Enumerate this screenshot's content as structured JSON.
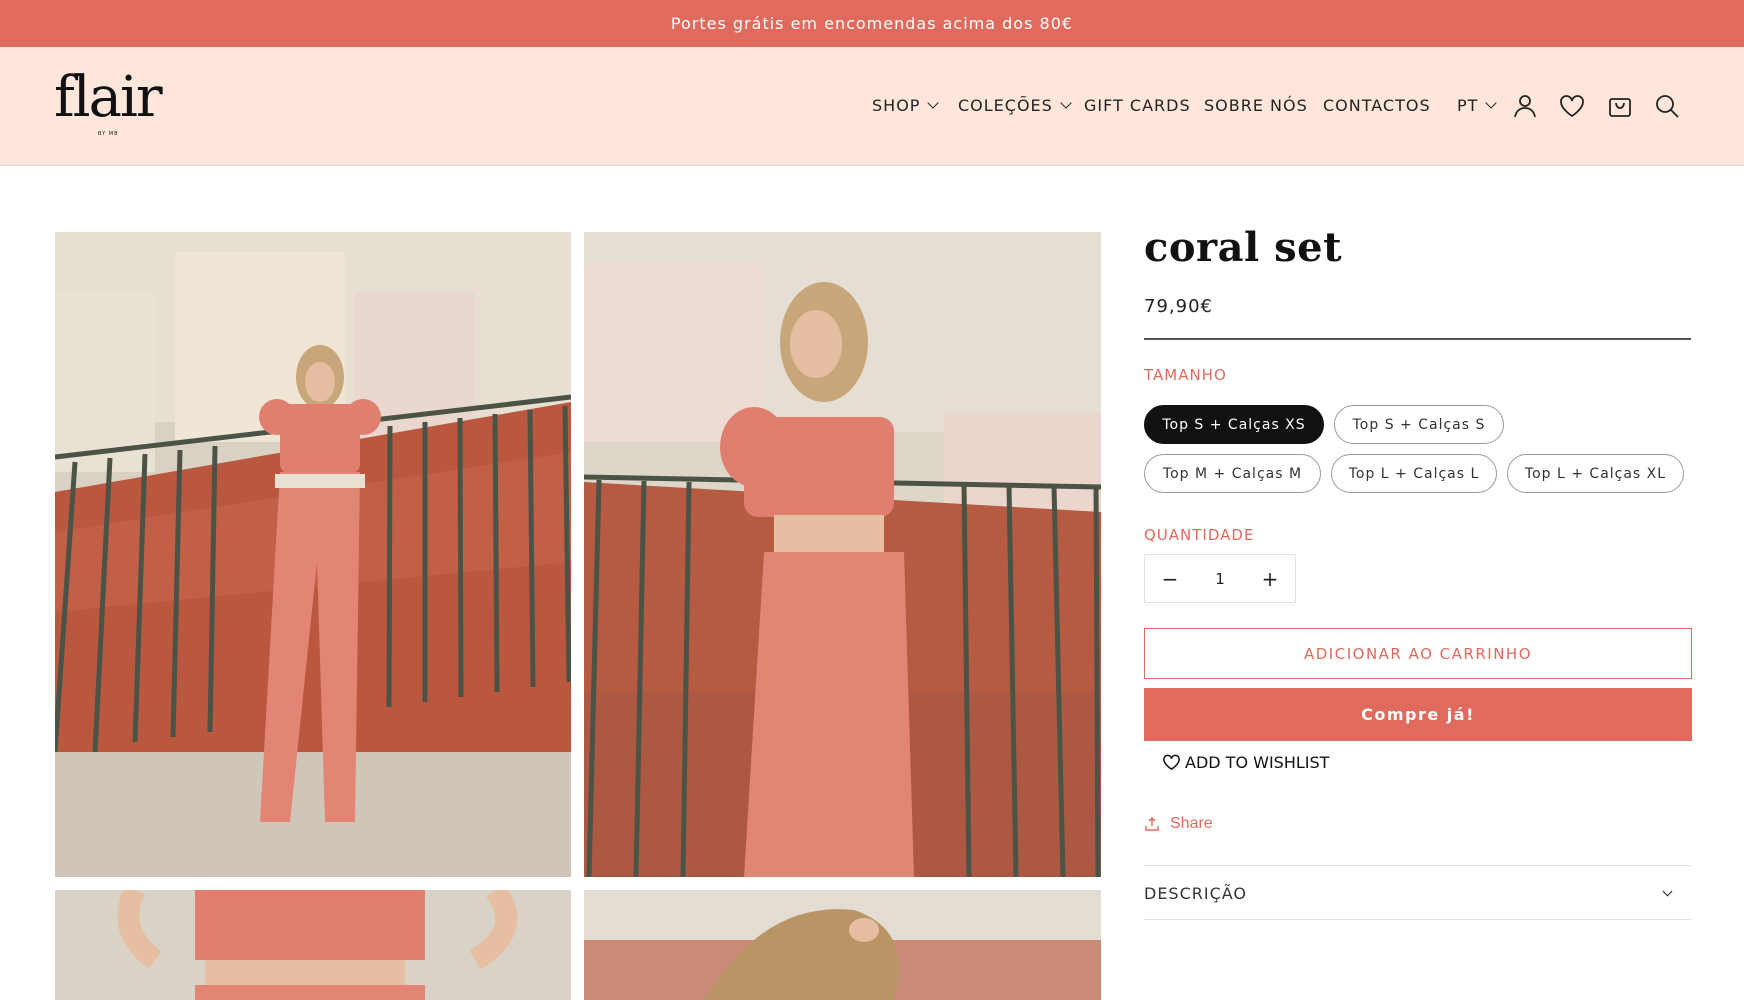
{
  "announcement": {
    "text": "Portes grátis em encomendas acima dos 80€"
  },
  "brand": {
    "name": "flair",
    "tagline": "BY MB"
  },
  "nav": {
    "items": [
      {
        "label": "SHOP",
        "has_dropdown": true
      },
      {
        "label": "COLEÇÕES",
        "has_dropdown": true
      },
      {
        "label": "GIFT CARDS",
        "has_dropdown": false
      },
      {
        "label": "SOBRE NÓS",
        "has_dropdown": false
      },
      {
        "label": "CONTACTOS",
        "has_dropdown": false
      }
    ],
    "language": "PT",
    "icons": [
      "account-icon",
      "heart-icon",
      "cart-icon",
      "search-icon"
    ]
  },
  "product": {
    "title": "coral set",
    "price": "79,90€",
    "size_label": "TAMANHO",
    "sizes": [
      {
        "label": "Top S + Calças XS",
        "selected": true
      },
      {
        "label": "Top S + Calças S",
        "selected": false
      },
      {
        "label": "Top M + Calças M",
        "selected": false
      },
      {
        "label": "Top L + Calças L",
        "selected": false
      },
      {
        "label": "Top L + Calças XL",
        "selected": false
      }
    ],
    "quantity_label": "QUANTIDADE",
    "quantity": "1",
    "add_to_cart": "ADICIONAR AO CARRINHO",
    "buy_now": "Compre já!",
    "wishlist": "ADD TO WISHLIST",
    "share": "Share",
    "description_label": "DESCRIÇÃO"
  },
  "colors": {
    "accent": "#e06a5d",
    "header_bg": "#fee7da",
    "selected_option": "#111111"
  }
}
